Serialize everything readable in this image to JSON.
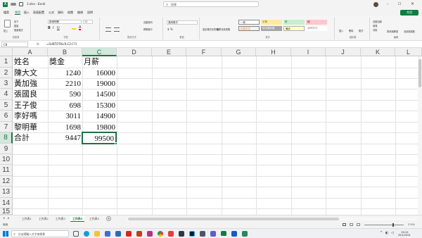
{
  "titlebar": {
    "filename": "1.xlsx - Excel",
    "search_placeholder": "搜尋",
    "share_label": "共用"
  },
  "menu": [
    "檔案",
    "常用",
    "插入",
    "頁面配置",
    "公式",
    "資料",
    "校閱",
    "檢視",
    "說明"
  ],
  "ribbon": {
    "paste": "貼上",
    "cut": "剪下",
    "copy": "複製",
    "format_painter": "複製格式",
    "clipboard": "剪貼簿",
    "font_name": "新細明體",
    "font_size": "12",
    "font_group": "字型",
    "wrap_text": "自動換列",
    "merge_center": "跨欄置中",
    "align_group": "對齊方式",
    "number_format": "通用格式",
    "number_group": "數值",
    "cond_format": "設定格式化的條件",
    "format_as_table": "格式化為表格",
    "styles": {
      "normal": "一般",
      "neutral": "中等",
      "good": "好",
      "bad": "壞",
      "calc": "計算方式",
      "check": "檢查儲存格",
      "note": "備註",
      "explain": "說明文字"
    },
    "styles_group": "樣式",
    "insert": "插入",
    "delete": "刪除",
    "format": "格式",
    "cells_group": "儲存格",
    "autosum": "自動加總",
    "fill": "填滿",
    "clear": "清除",
    "sort_filter": "排序與篩選",
    "find_select": "尋找與選取",
    "editing_group": "編輯"
  },
  "formula_bar": {
    "name_box": "C8",
    "fx": "fx",
    "formula": "=SUBTOTAL(9,C2:C7)"
  },
  "columns": [
    "A",
    "B",
    "C",
    "D",
    "E",
    "F",
    "G",
    "H",
    "I",
    "J",
    "K",
    "L"
  ],
  "rows": [
    "1",
    "2",
    "3",
    "4",
    "5",
    "6",
    "7",
    "8",
    "9",
    "10",
    "11",
    "12",
    "13",
    "14",
    "15"
  ],
  "table": {
    "headers": [
      "姓名",
      "獎金",
      "月薪"
    ],
    "rows": [
      [
        "陳大文",
        "1240",
        "16000"
      ],
      [
        "黃加強",
        "2210",
        "19000"
      ],
      [
        "張國良",
        "590",
        "14500"
      ],
      [
        "王子俊",
        "698",
        "15300"
      ],
      [
        "李好嗎",
        "3011",
        "14900"
      ],
      [
        "黎明華",
        "1698",
        "19800"
      ],
      [
        "合計",
        "9447",
        "99500"
      ]
    ]
  },
  "sheet_tabs": [
    "工作表1",
    "工作表2",
    "工作表3",
    "工作表5",
    "工作表4"
  ],
  "active_sheet_index": 3,
  "status": {
    "left": "就緒",
    "zoom": "274%"
  },
  "taskbar": {
    "search_placeholder": "在這裡輸入文字來搜尋",
    "time": "19:21",
    "date": "20/1/2024"
  },
  "colors": {
    "excel_green": "#107c41",
    "selection": "#1e7145",
    "header_bg": "#f0f0f0"
  }
}
